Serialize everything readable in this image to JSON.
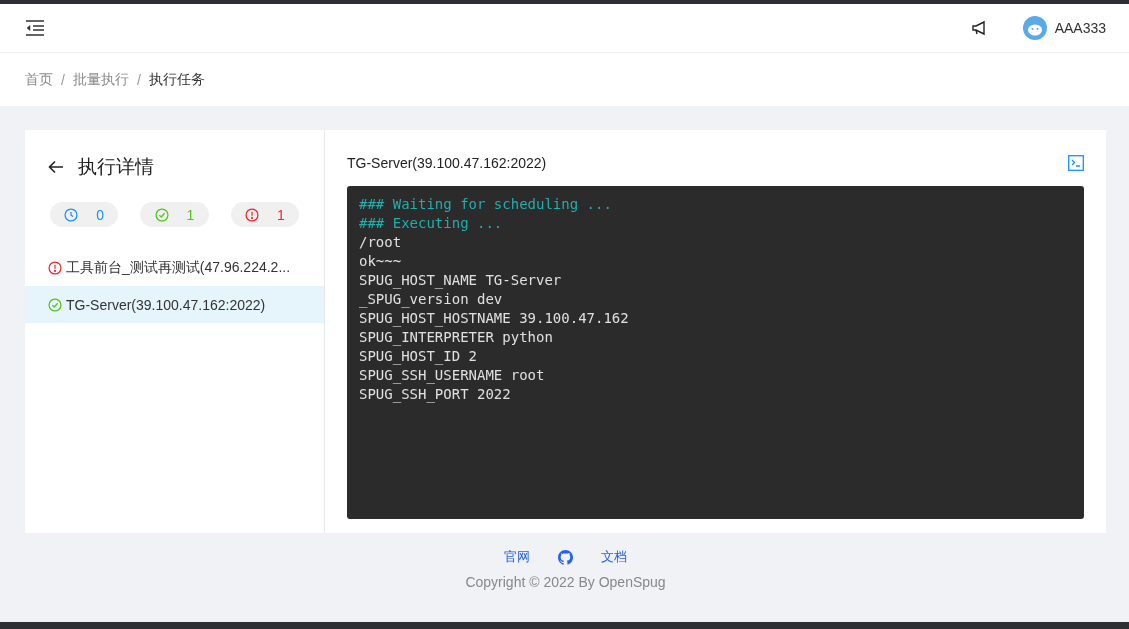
{
  "header": {
    "user": "AAA333"
  },
  "breadcrumb": [
    {
      "label": "首页",
      "current": false
    },
    {
      "separator": "/",
      "label": "批量执行",
      "current": false
    },
    {
      "separator": "/",
      "label": "执行任务",
      "current": true
    }
  ],
  "panel": {
    "title": "执行详情",
    "counts": [
      {
        "kind": "pending",
        "count": "0"
      },
      {
        "kind": "success",
        "count": "1"
      },
      {
        "kind": "error",
        "count": "1"
      }
    ],
    "hosts": [
      {
        "kind": "error",
        "label": "工具前台_测试再测试(47.96.224.2...",
        "selected": false
      },
      {
        "kind": "success",
        "label": "TG-Server(39.100.47.162:2022)",
        "selected": true
      }
    ]
  },
  "output": {
    "title": "TG-Server(39.100.47.162:2022)",
    "lines": [
      {
        "kind": "info",
        "text": "### Waiting for scheduling ..."
      },
      {
        "kind": "info",
        "text": "### Executing ..."
      },
      {
        "kind": "output",
        "text": "/root"
      },
      {
        "kind": "output",
        "text": "ok~~~"
      },
      {
        "kind": "output",
        "text": "SPUG_HOST_NAME TG-Server"
      },
      {
        "kind": "output",
        "text": "_SPUG_version dev"
      },
      {
        "kind": "output",
        "text": "SPUG_HOST_HOSTNAME 39.100.47.162"
      },
      {
        "kind": "output",
        "text": "SPUG_INTERPRETER python"
      },
      {
        "kind": "output",
        "text": "SPUG_HOST_ID 2"
      },
      {
        "kind": "output",
        "text": "SPUG_SSH_USERNAME root"
      },
      {
        "kind": "output",
        "text": "SPUG_SSH_PORT 2022"
      }
    ]
  },
  "footer": {
    "links": [
      "官网",
      "文档"
    ],
    "copyright": "Copyright © 2022 By OpenSpug"
  }
}
